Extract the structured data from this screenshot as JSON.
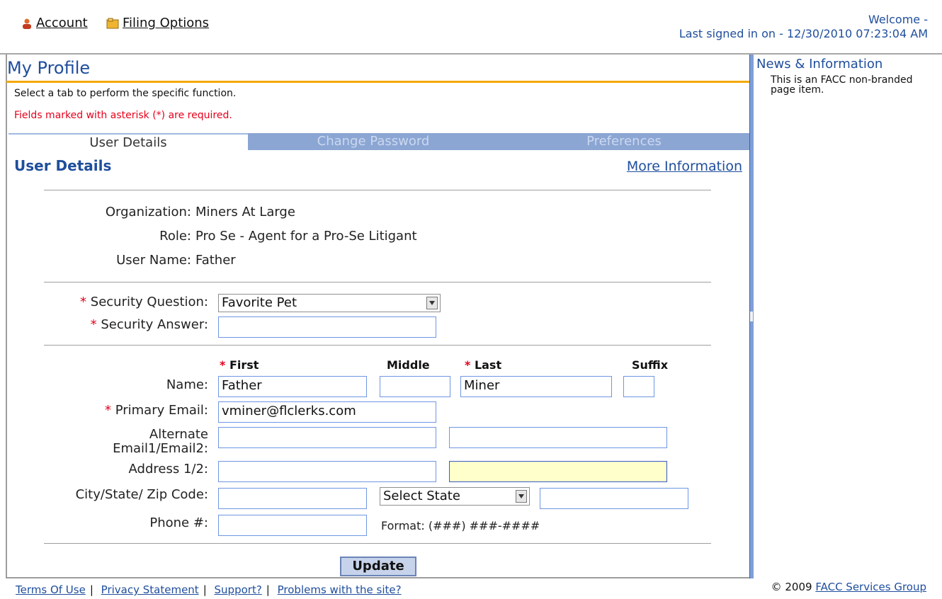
{
  "topbar": {
    "account_label": "Account",
    "filing_options_label": "Filing Options",
    "welcome_text": "Welcome -",
    "last_signed_in": "Last signed in on - 12/30/2010 07:23:04 AM"
  },
  "profile": {
    "title": "My Profile",
    "hint": "Select a tab to perform the specific function.",
    "required_note": "Fields marked with asterisk (*) are required."
  },
  "tabs": {
    "user_details": "User Details",
    "change_password": "Change Password",
    "preferences": "Preferences"
  },
  "section": {
    "heading": "User Details",
    "more_info": "More Information"
  },
  "details": {
    "organization_label": "Organization:",
    "organization_value": "Miners At Large",
    "role_label": "Role:",
    "role_value": "Pro Se - Agent for a Pro-Se Litigant",
    "username_label": "User Name:",
    "username_value": "Father"
  },
  "security": {
    "question_label": "Security Question:",
    "question_value": "Favorite Pet",
    "answer_label": "Security Answer:",
    "answer_value": ""
  },
  "name": {
    "first_header": "First",
    "middle_header": "Middle",
    "last_header": "Last",
    "suffix_header": "Suffix",
    "label": "Name:",
    "first_value": "Father",
    "middle_value": "",
    "last_value": "Miner",
    "suffix_value": ""
  },
  "contact": {
    "primary_email_label": "Primary Email:",
    "primary_email_value": "vminer@flclerks.com",
    "alternate_email_label_line1": "Alternate",
    "alternate_email_label_line2": "Email1/Email2:",
    "address_label": "Address 1/2:",
    "city_state_zip_label": "City/State/ Zip Code:",
    "state_select_value": "Select State",
    "phone_label": "Phone #:",
    "phone_format": "Format: (###) ###-####"
  },
  "actions": {
    "update_label": "Update"
  },
  "sidebar": {
    "title": "News & Information",
    "text": "This is an FACC non-branded page item."
  },
  "footer": {
    "terms": "Terms Of Use",
    "privacy": "Privacy Statement",
    "support": "Support?",
    "problems": "Problems with the site?",
    "copyright_prefix": "© 2009",
    "copyright_link": "FACC Services Group"
  },
  "colors": {
    "title_blue": "#1f4e9c",
    "accent_orange": "#f3a800",
    "required_red": "#e5001b",
    "tab_inactive": "#8ba6d3",
    "input_highlight": "#ffffcc"
  }
}
